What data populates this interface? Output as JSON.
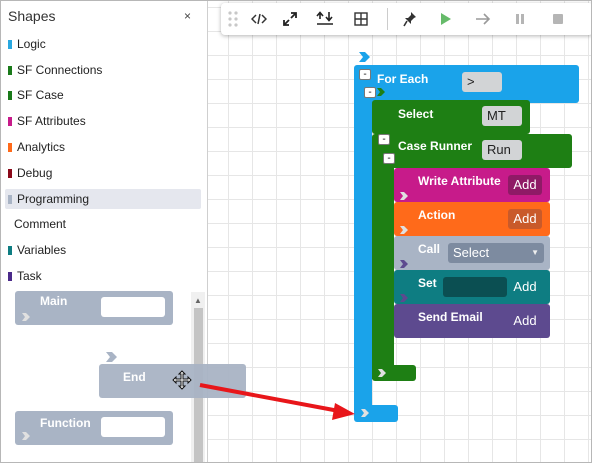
{
  "panel": {
    "title": "Shapes",
    "close": "×",
    "categories": [
      {
        "label": "Logic",
        "color": "#29a8e0"
      },
      {
        "label": "SF Connections",
        "color": "#1a7a1a"
      },
      {
        "label": "SF Case",
        "color": "#1a7a1a"
      },
      {
        "label": "SF Attributes",
        "color": "#c71b8a"
      },
      {
        "label": "Analytics",
        "color": "#ff6a1a"
      },
      {
        "label": "Debug",
        "color": "#8b0a1a"
      },
      {
        "label": "Programming",
        "color": "#a9b4c5"
      },
      {
        "label": "Comment",
        "color": ""
      },
      {
        "label": "Variables",
        "color": "#0e7d82"
      },
      {
        "label": "Task",
        "color": "#4b2a8a"
      }
    ],
    "palette": {
      "main": "Main",
      "end": "End",
      "function": "Function"
    }
  },
  "toolbar": {
    "icons": [
      "grip-icon",
      "code-icon",
      "expand-icon",
      "collapse-icon",
      "grid-icon",
      "pin-icon",
      "play-icon",
      "step-icon",
      "pause-icon",
      "stop-icon"
    ]
  },
  "blocks": {
    "for_each": {
      "title": "For Each",
      "field": ">"
    },
    "select": {
      "title": "Select",
      "field": "MT"
    },
    "case_runner": {
      "title": "Case Runner",
      "field": "Run"
    },
    "write_attribute": {
      "title": "Write Attribute",
      "button": "Add"
    },
    "action": {
      "title": "Action",
      "button": "Add"
    },
    "call": {
      "title": "Call",
      "dropdown": "Select"
    },
    "set": {
      "title": "Set",
      "button": "Add"
    },
    "send_email": {
      "title": "Send Email",
      "button": "Add"
    },
    "minus": "-"
  },
  "colors": {
    "logic": "#1aa3ea",
    "connections": "#1e7f14",
    "attributes": "#c71b8a",
    "analytics": "#ff6a1a",
    "programming": "#a9b4c5",
    "variables": "#0e7d82",
    "task": "#5d4a8f",
    "arrow": "#e8161a"
  }
}
